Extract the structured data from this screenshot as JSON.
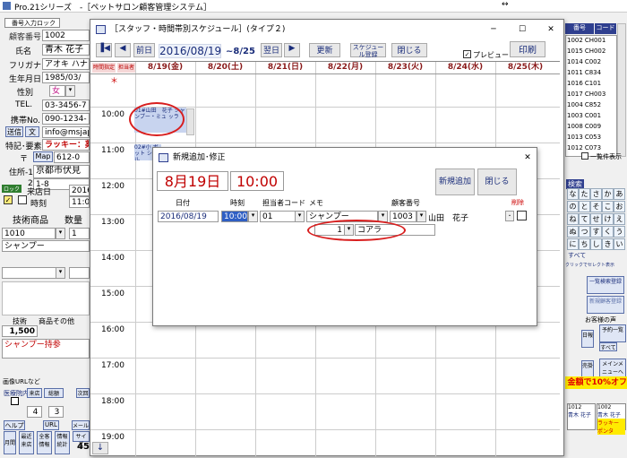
{
  "app": {
    "title": "Pro.21シリーズ　-［ペットサロン顧客管理システム］",
    "tray_icon_label": "↔"
  },
  "left": {
    "addr_label": "番号入力ロック",
    "customer_no_label": "顧客番号",
    "customer_no": "1002",
    "name_label": "氏名",
    "name": "青木 花子",
    "kana_label": "フリガナ",
    "kana": "アオキ ハナコ",
    "birth_label": "生年月日",
    "birth": "1985/03/",
    "gender_label": "性別",
    "gender": "女",
    "tel_label": "TEL.",
    "tel": "03-3456-7",
    "mobile_label": "携帯No.",
    "mobile": "090-1234-",
    "mail_btn": "送信",
    "text_btn": "文",
    "email": "info@msjap",
    "note_label": "特記･要素",
    "note": "ラッキー：薬",
    "zip_label": "〒",
    "map_btn": "Map",
    "zip": "612-0",
    "addr1_label": "住所-1",
    "addr1": "京都市伏見",
    "addr2_label": "2",
    "addr2": "1-8",
    "visit_label": "来店日",
    "visit": "2016",
    "time_label": "時刻",
    "time": "11:0",
    "tech_header": "技術商品",
    "qty_header": "数量",
    "item_code": "1010",
    "item_qty": "1",
    "item_name": "シャンプー",
    "tech_label": "技術",
    "product_label": "商品その他",
    "amount": "1,500",
    "memo": "シャンプー持参",
    "image_url": "画像URLなど",
    "vet_label": "医療院内",
    "vet_btn1": "来店",
    "vet_btn2": "総額",
    "vet_btn3": "次回",
    "count1": "4",
    "count2": "3",
    "help": "ヘルプ",
    "url": "URL",
    "mail2": "メール",
    "bottom1": "月間",
    "bottom2": "最近来店",
    "bottom3": "全客情報",
    "bottom4": "情報統計",
    "bottom5": "サイズ",
    "bottom_num": "45"
  },
  "right": {
    "header_no": "番号",
    "header_code": "コード",
    "rows": [
      {
        "no": "1002",
        "code": "CH001"
      },
      {
        "no": "1015",
        "code": "CH002"
      },
      {
        "no": "1014",
        "code": "C002"
      },
      {
        "no": "1011",
        "code": "C834"
      },
      {
        "no": "1016",
        "code": "C101"
      },
      {
        "no": "1017",
        "code": "CH003"
      },
      {
        "no": "1004",
        "code": "C852"
      },
      {
        "no": "1003",
        "code": "C001"
      },
      {
        "no": "1008",
        "code": "C009"
      },
      {
        "no": "1013",
        "code": "C053"
      },
      {
        "no": "1012",
        "code": "C073"
      }
    ],
    "list_all": "一覧件表示",
    "search_label": "検索",
    "kana_keys": [
      "な",
      "た",
      "さ",
      "か",
      "あ",
      "の",
      "と",
      "そ",
      "こ",
      "お",
      "ね",
      "て",
      "せ",
      "け",
      "え",
      "ぬ",
      "つ",
      "す",
      "く",
      "う",
      "に",
      "ち",
      "し",
      "き",
      "い"
    ],
    "all_btn": "すべて",
    "click_hint": "クリックでセレクト表示",
    "new_search": "一覧検索登録",
    "new_reg": "新規顧客登録",
    "voice_label": "お客様の声",
    "daily_btn": "日報",
    "schedule_btn": "予約一覧",
    "all_btn2": "すべて",
    "sales_btn": "売掛",
    "menu_btn": "メインメニューへ",
    "promo": "金額で10%オフ",
    "card1_no": "1012",
    "card1_name": "青木 花子",
    "card2_no": "1002",
    "card2_name": "青木 花子",
    "card2_pet": "ラッキー ポンタ"
  },
  "schedule": {
    "title": "［スタッフ・時間帯別スケジュール］(タイプ２)",
    "prev_day": "前日",
    "date": "2016/08/19",
    "range": "~8/25",
    "next_day": "翌日",
    "update": "更新",
    "sched_reg": "スケジュール登録",
    "close": "閉じる",
    "preview": "プレビュー",
    "print": "印刷",
    "time_label": "時間指定",
    "staff_label": "担当者",
    "days": [
      "8/19(金)",
      "8/20(土)",
      "8/21(日)",
      "8/22(月)",
      "8/23(火)",
      "8/24(水)",
      "8/25(木)"
    ],
    "hours": [
      "10:00",
      "11:00",
      "12:00",
      "13:00",
      "14:00",
      "15:00",
      "16:00",
      "17:00",
      "18:00",
      "19:00"
    ],
    "appt1": "01#山田　花子 シャンプー・ミュ ッラ",
    "appt2": "02#小 ボット シャ ル"
  },
  "dialog": {
    "title": "新規追加･修正",
    "date_big": "8月19日",
    "time_big": "10:00",
    "add_btn": "新規追加",
    "close_btn": "閉じる",
    "col_date": "日付",
    "col_time": "時刻",
    "col_staff": "担当者コード",
    "col_memo": "メモ",
    "col_cust": "顧客番号",
    "col_del": "削除",
    "row_date": "2016/08/19",
    "row_time": "10:00",
    "row_staff": "01",
    "row_memo": "シャンプー",
    "row_cust": "1003",
    "row_name": "山田　花子",
    "sub_no": "1",
    "sub_pet": "コアラ"
  }
}
